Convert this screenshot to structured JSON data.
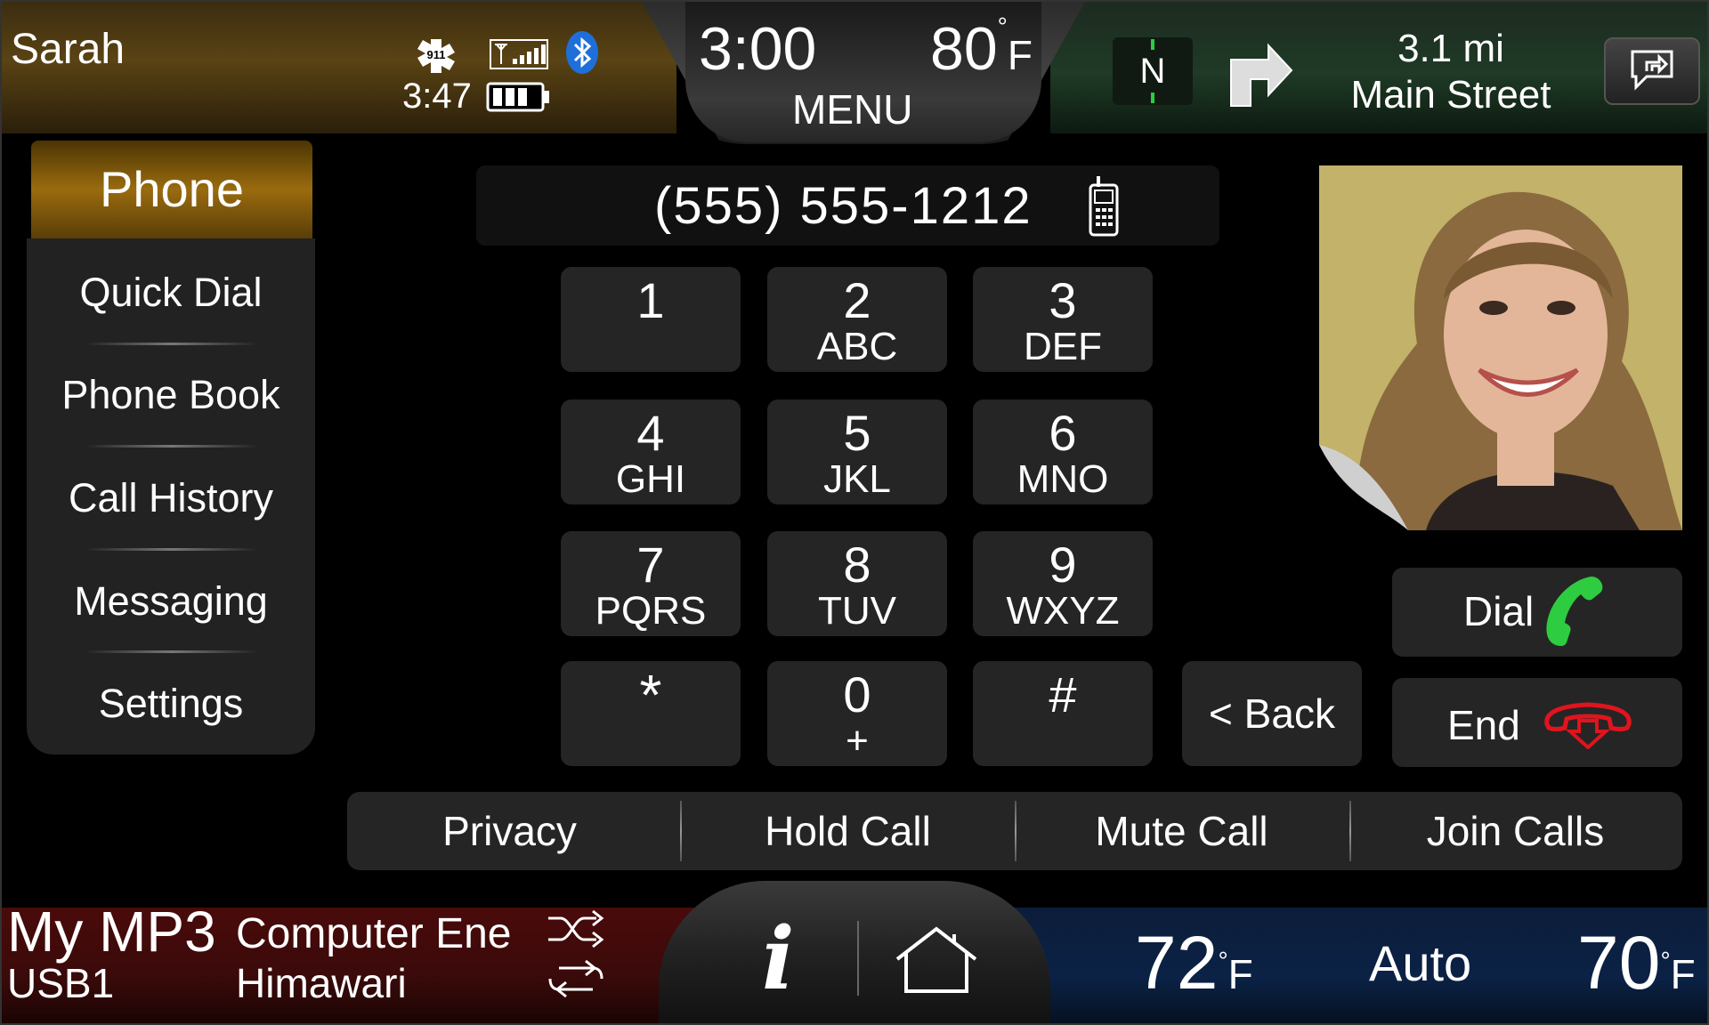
{
  "status_bar": {
    "user": "Sarah",
    "small_time": "3:47",
    "clock": "3:00",
    "outside_temp": "80",
    "temp_unit": "F",
    "menu_label": "MENU",
    "icons": [
      "911-assist-icon",
      "signal-strength-icon",
      "bluetooth-icon",
      "battery-icon"
    ]
  },
  "navigation": {
    "compass": "N",
    "distance": "3.1 mi",
    "street": "Main Street",
    "icons": [
      "compass-icon",
      "turn-right-arrow-icon",
      "voice-command-icon"
    ]
  },
  "sidebar": {
    "active_tab": "Phone",
    "items": [
      {
        "label": "Quick Dial"
      },
      {
        "label": "Phone Book"
      },
      {
        "label": "Call History"
      },
      {
        "label": "Messaging"
      },
      {
        "label": "Settings"
      }
    ]
  },
  "dialer": {
    "number": "(555) 555-1212",
    "keys": [
      {
        "digit": "1",
        "letters": ""
      },
      {
        "digit": "2",
        "letters": "ABC"
      },
      {
        "digit": "3",
        "letters": "DEF"
      },
      {
        "digit": "4",
        "letters": "GHI"
      },
      {
        "digit": "5",
        "letters": "JKL"
      },
      {
        "digit": "6",
        "letters": "MNO"
      },
      {
        "digit": "7",
        "letters": "PQRS"
      },
      {
        "digit": "8",
        "letters": "TUV"
      },
      {
        "digit": "9",
        "letters": "WXYZ"
      },
      {
        "digit": "*",
        "letters": ""
      },
      {
        "digit": "0",
        "letters": "+"
      },
      {
        "digit": "#",
        "letters": ""
      }
    ],
    "back_label": "< Back",
    "dial_label": "Dial",
    "end_label": "End"
  },
  "actions": {
    "privacy": "Privacy",
    "hold": "Hold Call",
    "mute": "Mute Call",
    "join": "Join Calls"
  },
  "media": {
    "title": "My MP3",
    "source": "USB1",
    "song": "Computer Ene",
    "artist": "Himawari",
    "icons": [
      "shuffle-icon",
      "repeat-icon"
    ]
  },
  "climate": {
    "driver_temp": "72",
    "mode": "Auto",
    "passenger_temp": "70",
    "unit": "F"
  },
  "colors": {
    "phone_accent": "#9a6b0e",
    "dial_green": "#2ecc40",
    "end_red": "#e0141e",
    "bluetooth_blue": "#1e6fd9"
  }
}
